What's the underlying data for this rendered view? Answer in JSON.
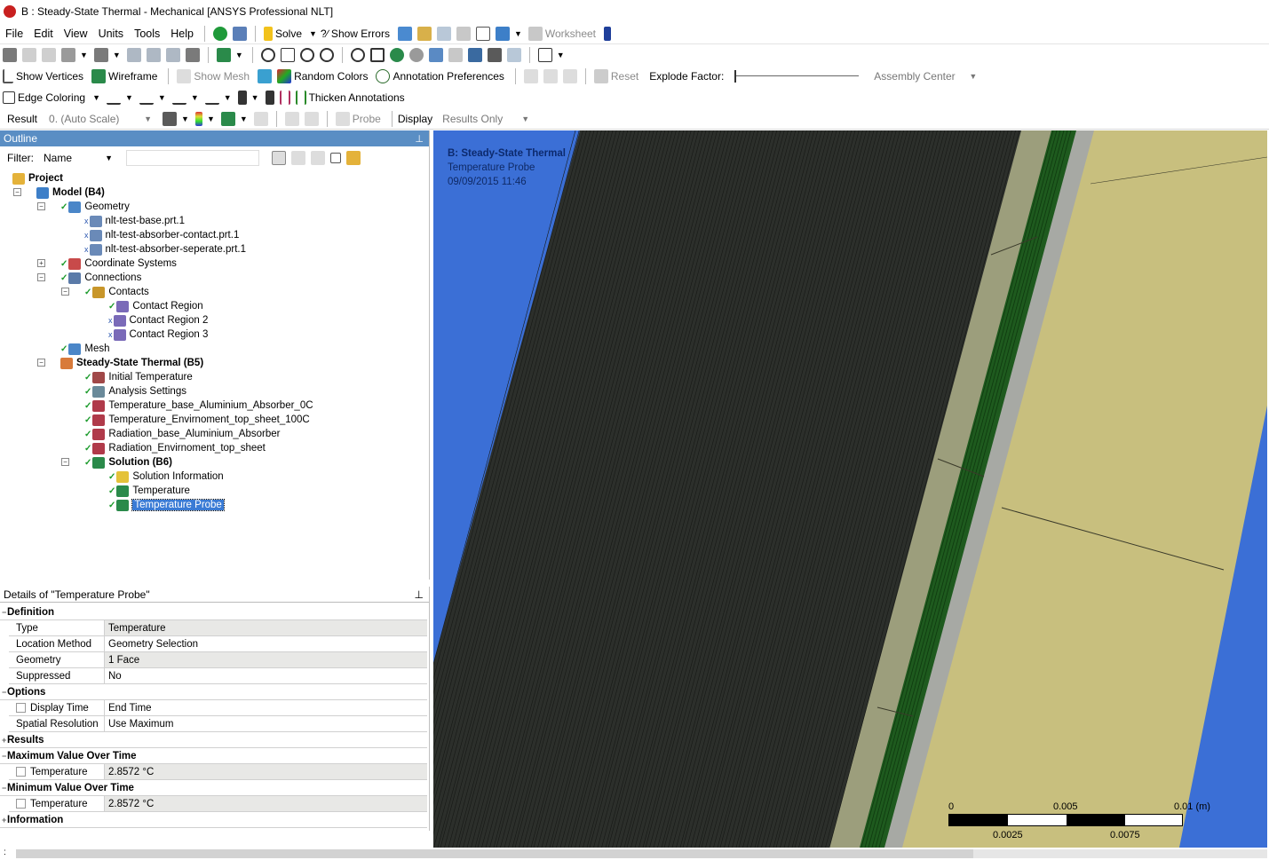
{
  "window": {
    "title": "B : Steady-State Thermal - Mechanical [ANSYS Professional NLT]"
  },
  "menubar": {
    "items": [
      "File",
      "Edit",
      "View",
      "Units",
      "Tools",
      "Help"
    ],
    "solve_label": "Solve",
    "show_errors_label": "?∕ Show Errors",
    "worksheet_label": "Worksheet"
  },
  "toolbar3": {
    "show_vertices": "Show Vertices",
    "wireframe": "Wireframe",
    "show_mesh": "Show Mesh",
    "random_colors": "Random Colors",
    "annotation_preferences": "Annotation Preferences",
    "reset": "Reset",
    "explode_factor": "Explode Factor:",
    "assembly_center": "Assembly Center"
  },
  "toolbar4": {
    "edge_coloring": "Edge Coloring",
    "thicken_annotations": "Thicken Annotations"
  },
  "resultbar": {
    "result_label": "Result",
    "scale_value": "0. (Auto Scale)",
    "probe_label": "Probe",
    "display_label": "Display",
    "display_value": "Results Only"
  },
  "outline": {
    "title": "Outline",
    "filter_label": "Filter:",
    "filter_value": "Name",
    "tree": [
      {
        "label": "Project",
        "level": 0,
        "bold": true
      },
      {
        "label": "Model (B4)",
        "level": 1,
        "bold": true
      },
      {
        "label": "Geometry",
        "level": 2
      },
      {
        "label": "nlt-test-base.prt.1",
        "level": 3
      },
      {
        "label": "nlt-test-absorber-contact.prt.1",
        "level": 3
      },
      {
        "label": "nlt-test-absorber-seperate.prt.1",
        "level": 3
      },
      {
        "label": "Coordinate Systems",
        "level": 2
      },
      {
        "label": "Connections",
        "level": 2
      },
      {
        "label": "Contacts",
        "level": 3
      },
      {
        "label": "Contact Region",
        "level": 4
      },
      {
        "label": "Contact Region 2",
        "level": 4
      },
      {
        "label": "Contact Region 3",
        "level": 4
      },
      {
        "label": "Mesh",
        "level": 2
      },
      {
        "label": "Steady-State Thermal (B5)",
        "level": 2,
        "bold": true
      },
      {
        "label": "Initial Temperature",
        "level": 3
      },
      {
        "label": "Analysis Settings",
        "level": 3
      },
      {
        "label": "Temperature_base_Aluminium_Absorber_0C",
        "level": 3
      },
      {
        "label": "Temperature_Envirnoment_top_sheet_100C",
        "level": 3
      },
      {
        "label": "Radiation_base_Aluminium_Absorber",
        "level": 3
      },
      {
        "label": "Radiation_Envirnoment_top_sheet",
        "level": 3
      },
      {
        "label": "Solution (B6)",
        "level": 3,
        "bold": true
      },
      {
        "label": "Solution Information",
        "level": 4
      },
      {
        "label": "Temperature",
        "level": 4
      },
      {
        "label": "Temperature Probe",
        "level": 4,
        "selected": true
      }
    ]
  },
  "details": {
    "title": "Details of \"Temperature Probe\"",
    "groups": [
      {
        "name": "Definition",
        "rows": [
          {
            "key": "Type",
            "value": "Temperature",
            "shaded": true
          },
          {
            "key": "Location Method",
            "value": "Geometry Selection"
          },
          {
            "key": "Geometry",
            "value": "1 Face",
            "shaded": true
          },
          {
            "key": "Suppressed",
            "value": "No"
          }
        ]
      },
      {
        "name": "Options",
        "rows": [
          {
            "key": "Display Time",
            "value": "End Time",
            "checkbox": true
          },
          {
            "key": "Spatial Resolution",
            "value": "Use Maximum"
          }
        ]
      },
      {
        "name": "Results",
        "rows": []
      },
      {
        "name": "Maximum Value Over Time",
        "rows": [
          {
            "key": "Temperature",
            "value": "2.8572 °C",
            "checkbox": true,
            "shaded": true
          }
        ]
      },
      {
        "name": "Minimum Value Over Time",
        "rows": [
          {
            "key": "Temperature",
            "value": "2.8572 °C",
            "checkbox": true,
            "shaded": true
          }
        ]
      },
      {
        "name": "Information",
        "rows": []
      }
    ]
  },
  "viewport": {
    "info_title": "B: Steady-State Thermal",
    "info_subtitle": "Temperature Probe",
    "info_date": "09/09/2015 11:46",
    "scale": {
      "top_labels": [
        "0",
        "0.005",
        "0.01 (m)"
      ],
      "bottom_labels": [
        "0.0025",
        "0.0075"
      ]
    },
    "colors": {
      "background": "#3b6fd6",
      "mesh_dark": "#2c2f2b",
      "tan": "#c8bf7e",
      "gray_strip": "#a7a9a4",
      "green_strip": "#1e5a1e",
      "olive_strip": "#9c9e7c"
    }
  }
}
